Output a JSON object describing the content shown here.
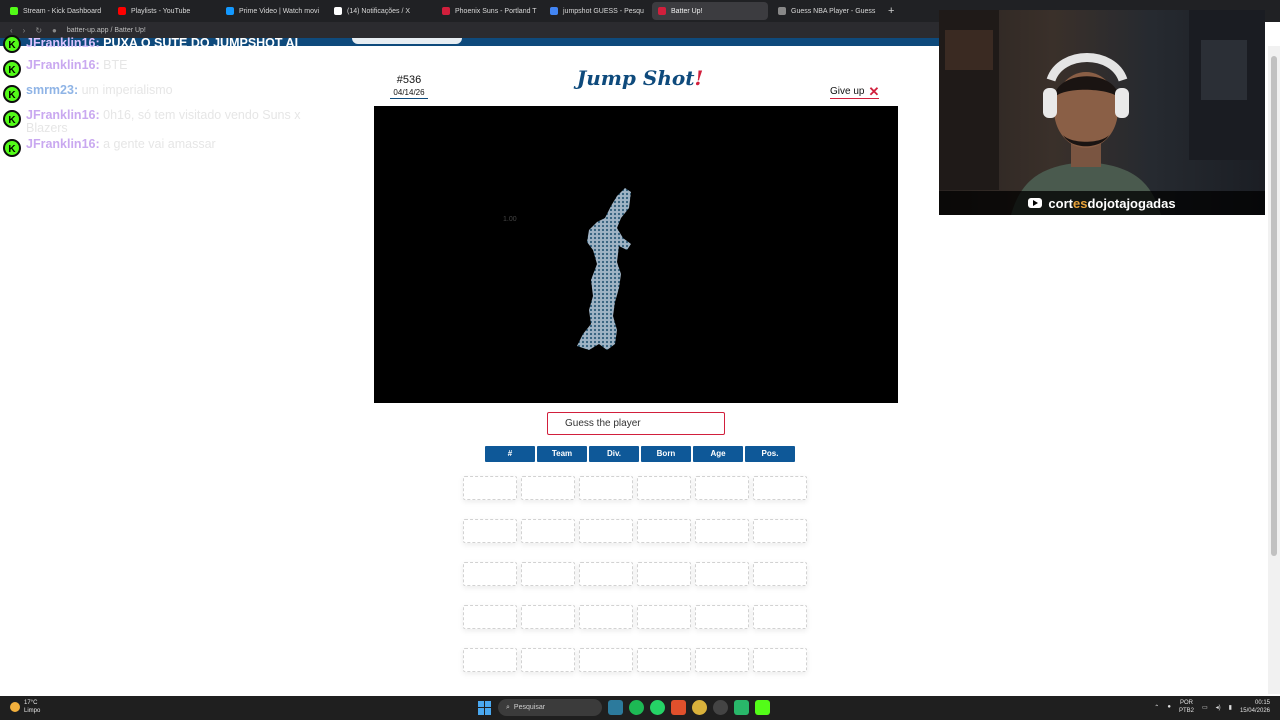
{
  "browser": {
    "tabs": [
      {
        "label": "Stream - Kick Dashboard",
        "icon": "kick-icon",
        "color": "#53fc18"
      },
      {
        "label": "Playlists - YouTube",
        "icon": "youtube-icon",
        "color": "#ff0000"
      },
      {
        "label": "Prime Video | Watch movi",
        "icon": "prime-video-icon",
        "color": "#1399ff"
      },
      {
        "label": "(14) Notificações / X",
        "icon": "x-icon",
        "color": "#ffffff"
      },
      {
        "label": "Phoenix Suns - Portland T",
        "icon": "sports-icon",
        "color": "#d11f3c"
      },
      {
        "label": "jumpshot GUESS - Pesqu",
        "icon": "google-icon",
        "color": "#4285f4"
      },
      {
        "label": "Batter Up!",
        "icon": "batter-up-icon",
        "color": "#d11f3c"
      },
      {
        "label": "Guess NBA Player - Guess",
        "icon": "globe-icon",
        "color": "#888888"
      }
    ],
    "active_tab": 6,
    "url": "batter-up.app / Batter Up!"
  },
  "chat": {
    "messages": [
      {
        "user": "JFranklin16:",
        "text": "PUXA O SUTE DO JUMPSHOT AI"
      },
      {
        "user": "JFranklin16:",
        "text": "BTE"
      },
      {
        "user": "smrm23:",
        "text": "um imperialismo"
      },
      {
        "user": "JFranklin16:",
        "text": "0h16, só tem visitado vendo Suns x Blazers"
      },
      {
        "user": "JFranklin16:",
        "text": "a gente vai amassar"
      }
    ],
    "badge_letter": "K",
    "badge_color": "#53fc18"
  },
  "game": {
    "puzzle_number": "#536",
    "date": "04/14/26",
    "title": "Jump Shot",
    "title_mark": "!",
    "give_up_label": "Give up",
    "give_up_icon": "close-x-icon",
    "zoom_text": "1.00",
    "guess_placeholder": "Guess the player",
    "columns": [
      "#",
      "Team",
      "Div.",
      "Born",
      "Age",
      "Pos."
    ],
    "guess_rows": 5,
    "accent_color": "#0e4a7c",
    "highlight_color": "#d11f3c"
  },
  "webcam": {
    "channel_prefix": "cort",
    "channel_highlight": "es",
    "channel_suffix": "dojotajogadas",
    "platform_icon": "youtube-icon"
  },
  "taskbar": {
    "temperature": "17°C",
    "weather_text": "Limpo",
    "search_placeholder": "Pesquisar",
    "language": "POR",
    "layout": "PTB2",
    "time": "00:15",
    "date": "15/04/2026"
  }
}
